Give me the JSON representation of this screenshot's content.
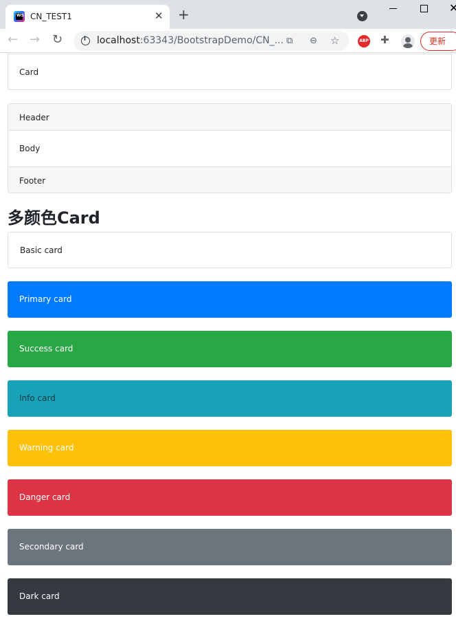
{
  "browser": {
    "tab_title": "CN_TEST1",
    "tab_close": "✕",
    "new_tab": "+",
    "url_host": "localhost",
    "url_rest": ":63343/BootstrapDemo/CN_...",
    "abp_label": "ABP",
    "update_label": "更新"
  },
  "page": {
    "simple_card": {
      "body": "Card"
    },
    "hbf_card": {
      "header": "Header",
      "body": "Body",
      "footer": "Footer"
    },
    "section_heading": "多颜色Card",
    "color_cards": {
      "basic": "Basic card",
      "primary": "Primary card",
      "success": "Success card",
      "info": "Info card",
      "warning": "Warning card",
      "danger": "Danger card",
      "secondary": "Secondary card",
      "dark": "Dark card"
    }
  },
  "colors": {
    "primary": "#007bff",
    "success": "#28a745",
    "info": "#17a2b8",
    "warning": "#ffc107",
    "danger": "#dc3545",
    "secondary": "#6c757d",
    "dark": "#343a40",
    "update_button": "#d93025"
  }
}
